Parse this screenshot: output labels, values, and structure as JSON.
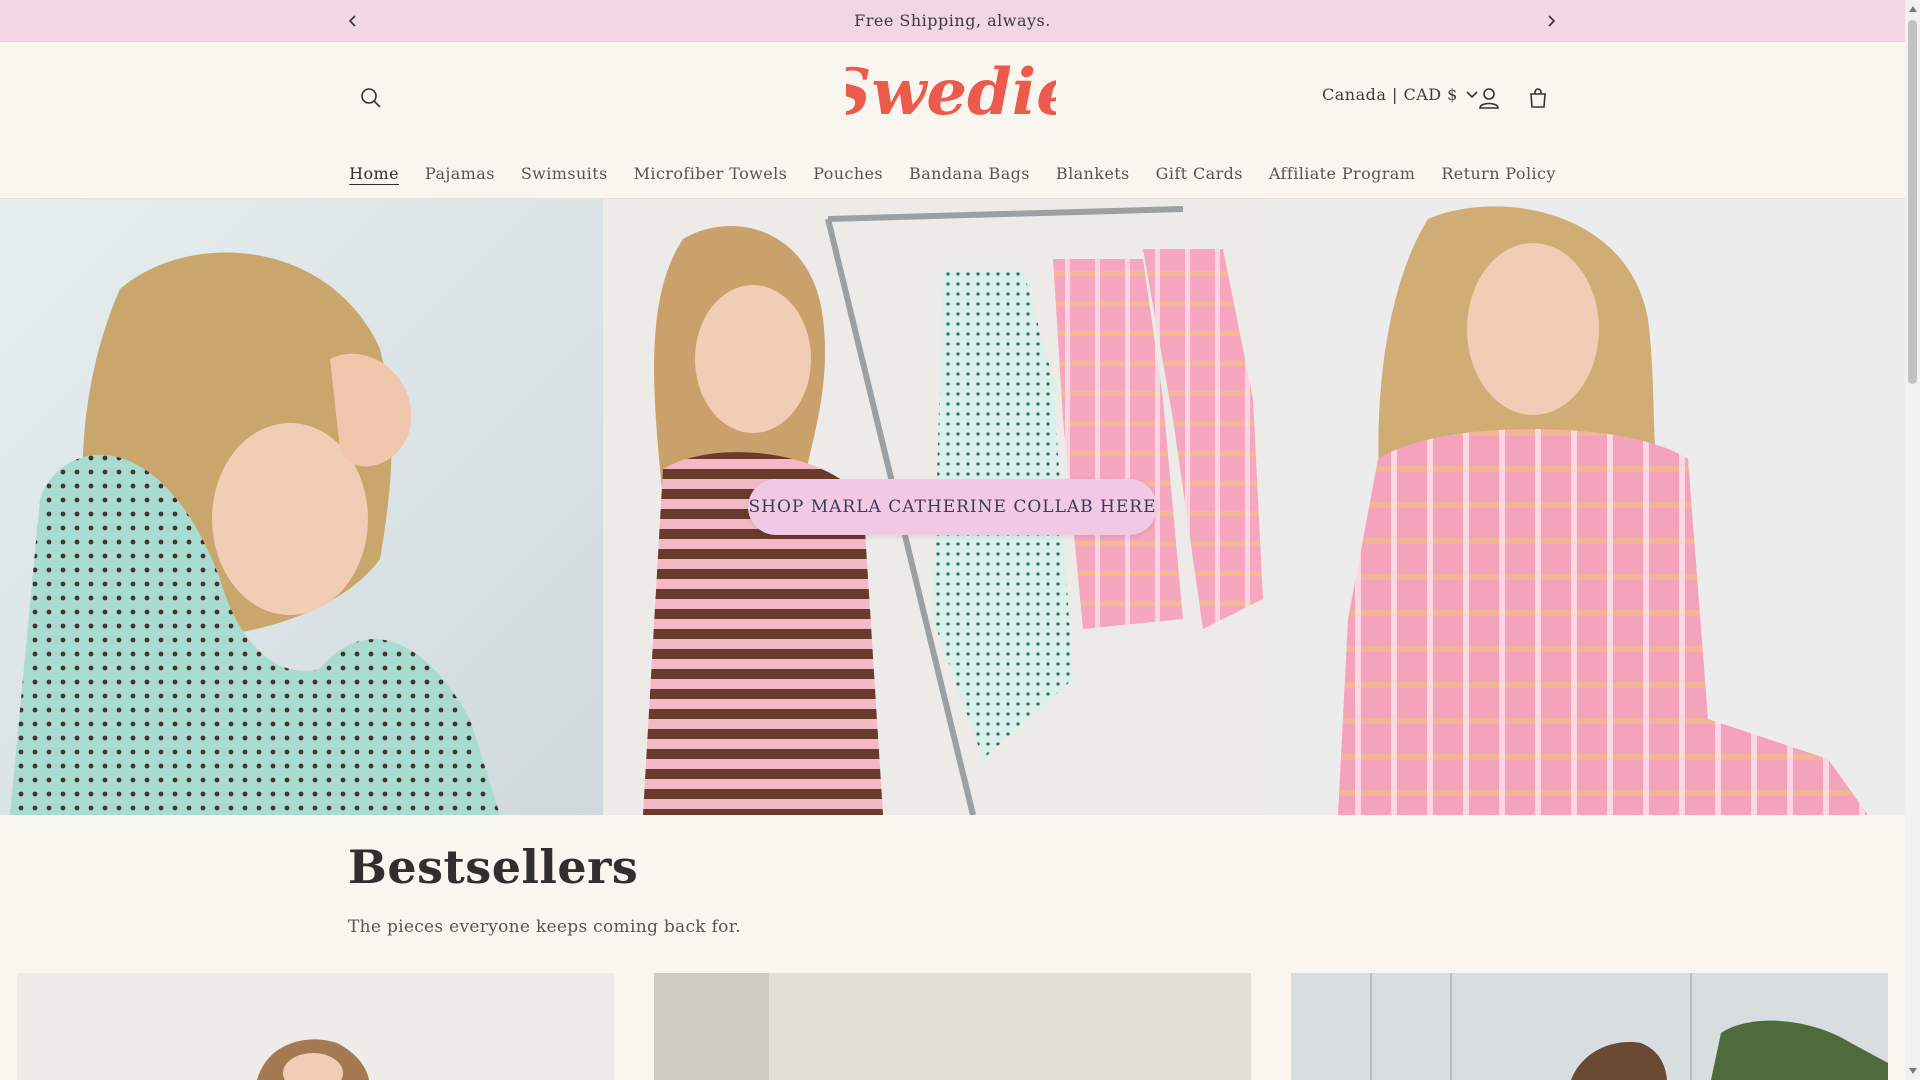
{
  "announcement": {
    "message": "Free Shipping, always.",
    "prev_icon": "chevron-left-icon",
    "next_icon": "chevron-right-icon"
  },
  "header": {
    "logo_text": "Swedie",
    "currency": "Canada | CAD $",
    "icons": [
      "search-icon",
      "user-icon",
      "cart-icon",
      "chevron-down-icon"
    ]
  },
  "nav": {
    "items": [
      "Home",
      "Pajamas",
      "Swimsuits",
      "Microfiber Towels",
      "Pouches",
      "Bandana Bags",
      "Blankets",
      "Gift Cards",
      "Affiliate Program",
      "Return Policy"
    ],
    "active": "Home"
  },
  "hero": {
    "cta_label": "SHOP MARLA CATHERINE COLLAB HERE"
  },
  "bestsellers": {
    "title": "Bestsellers",
    "subtitle": "The pieces everyone keeps coming back for."
  },
  "colors": {
    "announcement_bg": "#f1d6e6",
    "logo": "#ec5a4b",
    "cta_bg": "#f1c9e5",
    "page_bg": "#f9f6f0"
  }
}
